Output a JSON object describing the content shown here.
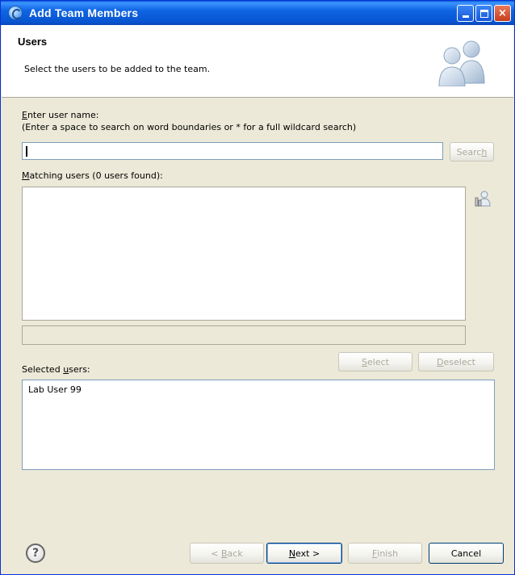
{
  "window": {
    "title": "Add Team Members",
    "controls": {
      "minimize": "_",
      "maximize": "□",
      "close": "×"
    }
  },
  "header": {
    "title": "Users",
    "description": "Select the users to be added to the team.",
    "icon": "users-group-icon"
  },
  "search": {
    "label_mnemonic": "E",
    "label_rest": "nter user name:",
    "hint": "(Enter a space to search on word boundaries or * for a full wildcard search)",
    "value": "",
    "button_label_pre": "Searc",
    "button_label_mnemonic": "h",
    "button_enabled": false
  },
  "matching": {
    "label_mnemonic": "M",
    "label_rest": "atching users (0 users found):",
    "items": [],
    "icon": "user-search-icon"
  },
  "actions": {
    "select_mnemonic": "S",
    "select_rest": "elect",
    "deselect_mnemonic": "D",
    "deselect_rest": "eselect"
  },
  "selected": {
    "label_pre": "Selected ",
    "label_mnemonic": "u",
    "label_rest": "sers:",
    "items": [
      "Lab User 99"
    ]
  },
  "footer": {
    "help_icon": "help-icon",
    "help_glyph": "?",
    "back_prefix": "< ",
    "back_mnemonic": "B",
    "back_rest": "ack",
    "next_mnemonic": "N",
    "next_rest": "ext >",
    "finish_mnemonic": "F",
    "finish_rest": "inish",
    "cancel": "Cancel"
  }
}
